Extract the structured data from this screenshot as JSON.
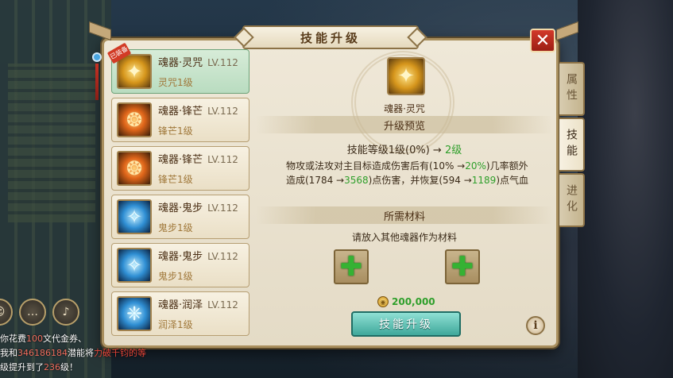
{
  "window": {
    "title": "技能升级"
  },
  "close": {
    "label": "✕"
  },
  "skills": [
    {
      "name": "魂器·灵咒",
      "level": "LV.112",
      "sub": "灵咒1级",
      "tag": "已装备",
      "selected": true,
      "icon": "gold-spirit-icon"
    },
    {
      "name": "魂器·锋芒",
      "level": "LV.112",
      "sub": "锋芒1级",
      "selected": false,
      "icon": "fire-slash-icon"
    },
    {
      "name": "魂器·锋芒",
      "level": "LV.112",
      "sub": "锋芒1级",
      "selected": false,
      "icon": "fire-slash-icon"
    },
    {
      "name": "魂器·鬼步",
      "level": "LV.112",
      "sub": "鬼步1级",
      "selected": false,
      "icon": "blue-step-icon"
    },
    {
      "name": "魂器·鬼步",
      "level": "LV.112",
      "sub": "鬼步1级",
      "selected": false,
      "icon": "blue-step-icon"
    },
    {
      "name": "魂器·润泽",
      "level": "LV.112",
      "sub": "润泽1级",
      "selected": false,
      "icon": "blue-moist-icon"
    }
  ],
  "detail": {
    "name": "魂器·灵咒",
    "preview_title": "升级预览",
    "level_prefix": "技能等级1级(0%) →",
    "level_next": "2级",
    "desc_part1": "物攻或法攻对主目标造成伤害后有(10% →",
    "desc_green1": "20%",
    "desc_part2": ")几率额外造成(1784 →",
    "desc_green2": "3568",
    "desc_part3": ")点伤害，并恢复(594 →",
    "desc_green3": "1189",
    "desc_part4": ")点气血",
    "materials_title": "所需材料",
    "materials_hint": "请放入其他魂器作为材料",
    "slot_symbol": "✚",
    "cost": "200,000",
    "upgrade_label": "技能升级",
    "info_label": "i"
  },
  "tabs": [
    {
      "label": "属性",
      "active": false
    },
    {
      "label": "技能",
      "active": true
    },
    {
      "label": "进化",
      "active": false
    }
  ],
  "chat": {
    "lines": [
      {
        "a": "",
        "b": "你花费",
        "c": "100",
        "d": "文代金券、"
      },
      {
        "a": "我和",
        "b": "346186184",
        "c": "潜能将",
        "d": "力破千钧的等"
      },
      {
        "a": "级提升到了",
        "b": "236",
        "c": "级！",
        "d": ""
      }
    ]
  },
  "colors": {
    "accent_green": "#2f9f2b",
    "close_red": "#c8301f",
    "panel": "#efe8d8"
  }
}
